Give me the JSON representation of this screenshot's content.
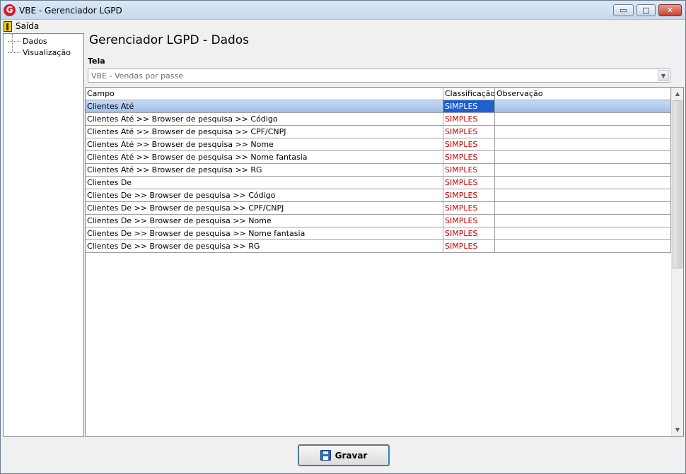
{
  "window": {
    "title": "VBE - Gerenciador LGPD",
    "app_icon_letter": "G",
    "controls": {
      "minimize": "▭",
      "maximize": "□",
      "close": "✕"
    }
  },
  "menubar": {
    "exit_label": "Saída",
    "exit_icon": "exit-door-icon"
  },
  "sidebar": {
    "items": [
      {
        "label": "Dados"
      },
      {
        "label": "Visualização"
      }
    ]
  },
  "main": {
    "title": "Gerenciador LGPD - Dados",
    "tela_label": "Tela",
    "tela_value": "VBE - Vendas por passe"
  },
  "grid": {
    "columns": [
      "Campo",
      "Classificação",
      "Observação"
    ],
    "rows": [
      {
        "campo": "Clientes Até",
        "classificacao": "SIMPLES",
        "observacao": ""
      },
      {
        "campo": "Clientes Até >> Browser de pesquisa >> Código",
        "classificacao": "SIMPLES",
        "observacao": ""
      },
      {
        "campo": "Clientes Até >> Browser de pesquisa >> CPF/CNPJ",
        "classificacao": "SIMPLES",
        "observacao": ""
      },
      {
        "campo": "Clientes Até >> Browser de pesquisa >> Nome",
        "classificacao": "SIMPLES",
        "observacao": ""
      },
      {
        "campo": "Clientes Até >> Browser de pesquisa >> Nome fantasia",
        "classificacao": "SIMPLES",
        "observacao": ""
      },
      {
        "campo": "Clientes Até >> Browser de pesquisa >> RG",
        "classificacao": "SIMPLES",
        "observacao": ""
      },
      {
        "campo": "Clientes De",
        "classificacao": "SIMPLES",
        "observacao": ""
      },
      {
        "campo": "Clientes De >> Browser de pesquisa >> Código",
        "classificacao": "SIMPLES",
        "observacao": ""
      },
      {
        "campo": "Clientes De >> Browser de pesquisa >> CPF/CNPJ",
        "classificacao": "SIMPLES",
        "observacao": ""
      },
      {
        "campo": "Clientes De >> Browser de pesquisa >> Nome",
        "classificacao": "SIMPLES",
        "observacao": ""
      },
      {
        "campo": "Clientes De >> Browser de pesquisa >> Nome fantasia",
        "classificacao": "SIMPLES",
        "observacao": ""
      },
      {
        "campo": "Clientes De >> Browser de pesquisa >> RG",
        "classificacao": "SIMPLES",
        "observacao": ""
      }
    ],
    "selected_row": 0
  },
  "footer": {
    "save_label": "Gravar",
    "save_icon": "floppy-disk-icon"
  },
  "colors": {
    "classification_text": "#cc0000",
    "selection": "#1f5fcf"
  }
}
